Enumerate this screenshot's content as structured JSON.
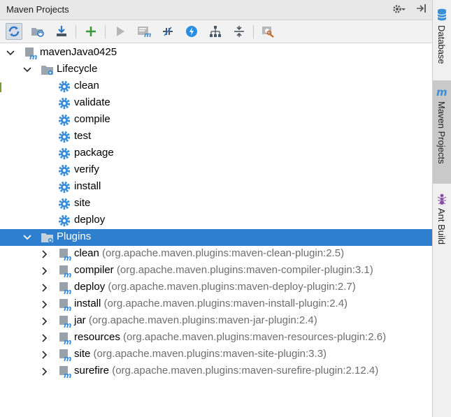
{
  "panel": {
    "title": "Maven Projects",
    "settings_icon": "gear-icon",
    "hide_icon": "hide-panel-icon"
  },
  "toolbar": {
    "buttons": [
      {
        "name": "reimport-button",
        "icon": "refresh-icon"
      },
      {
        "name": "generate-sources-button",
        "icon": "folder-refresh-icon"
      },
      {
        "name": "download-sources-button",
        "icon": "download-icon"
      },
      {
        "name": "add-project-button",
        "icon": "plus-icon"
      },
      {
        "name": "run-button",
        "icon": "play-icon"
      },
      {
        "name": "execute-goal-button",
        "icon": "maven-run-icon"
      },
      {
        "name": "toggle-offline-button",
        "icon": "offline-icon"
      },
      {
        "name": "skip-tests-button",
        "icon": "lightning-icon"
      },
      {
        "name": "show-dependencies-button",
        "icon": "diagram-icon"
      },
      {
        "name": "collapse-all-button",
        "icon": "collapse-icon"
      },
      {
        "name": "settings-button",
        "icon": "wrench-icon"
      }
    ]
  },
  "tree": {
    "project": "mavenJava0425",
    "lifecycle_label": "Lifecycle",
    "lifecycle": [
      "clean",
      "validate",
      "compile",
      "test",
      "package",
      "verify",
      "install",
      "site",
      "deploy"
    ],
    "plugins_label": "Plugins",
    "plugins": [
      {
        "name": "clean",
        "coord": "(org.apache.maven.plugins:maven-clean-plugin:2.5)"
      },
      {
        "name": "compiler",
        "coord": "(org.apache.maven.plugins:maven-compiler-plugin:3.1)"
      },
      {
        "name": "deploy",
        "coord": "(org.apache.maven.plugins:maven-deploy-plugin:2.7)"
      },
      {
        "name": "install",
        "coord": "(org.apache.maven.plugins:maven-install-plugin:2.4)"
      },
      {
        "name": "jar",
        "coord": "(org.apache.maven.plugins:maven-jar-plugin:2.4)"
      },
      {
        "name": "resources",
        "coord": "(org.apache.maven.plugins:maven-resources-plugin:2.6)"
      },
      {
        "name": "site",
        "coord": "(org.apache.maven.plugins:maven-site-plugin:3.3)"
      },
      {
        "name": "surefire",
        "coord": "(org.apache.maven.plugins:maven-surefire-plugin:2.12.4)"
      }
    ]
  },
  "sidebar": {
    "tabs": [
      {
        "label": "Database",
        "icon": "database-icon"
      },
      {
        "label": "Maven Projects",
        "icon": "maven-icon"
      },
      {
        "label": "Ant Build",
        "icon": "ant-icon"
      }
    ]
  },
  "colors": {
    "selection": "#2f7fcf",
    "gear": "#3a8fd8",
    "coord_text": "#6e6e6e"
  }
}
